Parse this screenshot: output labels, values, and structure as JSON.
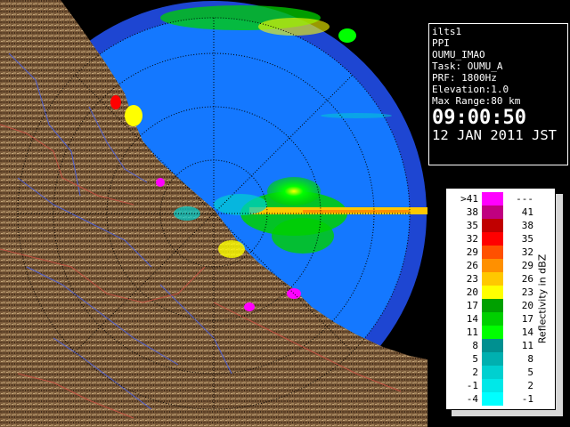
{
  "info": {
    "site": "ilts1",
    "product": "PPI",
    "scan_name": "OUMU_IMAO",
    "task": "Task: OUMU_A",
    "prf": "PRF: 1800Hz",
    "elevation": "Elevation:1.0",
    "max_range": "Max Range:80 km",
    "time": "09:00:50",
    "date": "12 JAN 2011 JST"
  },
  "legend": {
    "title": "Reflectivity in dBZ",
    "rows": [
      {
        "low": ">41",
        "high": "---",
        "color": "#ff00ff"
      },
      {
        "low": "38",
        "high": "41",
        "color": "#c00080"
      },
      {
        "low": "35",
        "high": "38",
        "color": "#c00000"
      },
      {
        "low": "32",
        "high": "35",
        "color": "#ff0000"
      },
      {
        "low": "29",
        "high": "32",
        "color": "#ff5000"
      },
      {
        "low": "26",
        "high": "29",
        "color": "#ff9000"
      },
      {
        "low": "23",
        "high": "26",
        "color": "#ffc800"
      },
      {
        "low": "20",
        "high": "23",
        "color": "#ffff00"
      },
      {
        "low": "17",
        "high": "20",
        "color": "#00a000"
      },
      {
        "low": "14",
        "high": "17",
        "color": "#00d000"
      },
      {
        "low": "11",
        "high": "14",
        "color": "#00ff00"
      },
      {
        "low": "8",
        "high": "11",
        "color": "#009090"
      },
      {
        "low": "5",
        "high": "8",
        "color": "#00b0b0"
      },
      {
        "low": "2",
        "high": "5",
        "color": "#00d0d0"
      },
      {
        "low": "-1",
        "high": "2",
        "color": "#00e8e8"
      },
      {
        "low": "-4",
        "high": "-1",
        "color": "#00ffff"
      }
    ]
  },
  "colors": {
    "sea_inner": "#1478ff",
    "sea_outer": "#1e46d2",
    "land": "#7a5a3a",
    "range_ring": "#000000",
    "rivers": "#5060d0",
    "borders": "#c05040"
  }
}
